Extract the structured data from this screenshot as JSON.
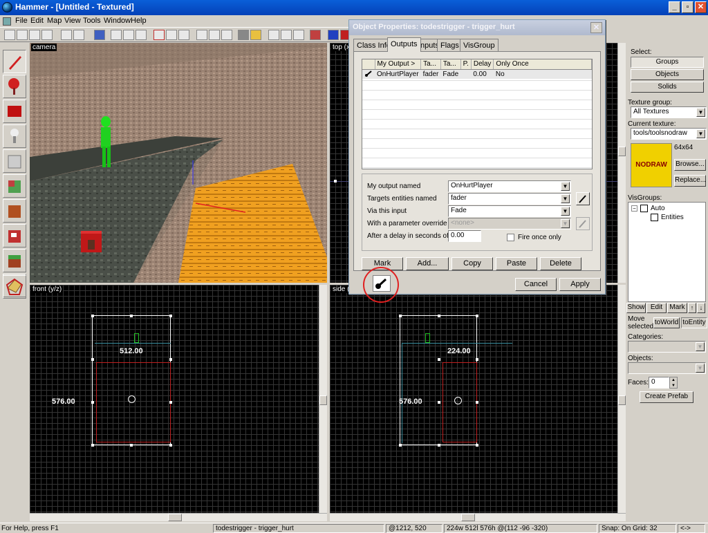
{
  "app": {
    "title": "Hammer - [Untitled - Textured]"
  },
  "menu": [
    "File",
    "Edit",
    "Map",
    "View",
    "Tools",
    "Window",
    "Help"
  ],
  "viewports": {
    "camera": "camera",
    "top": "top (x/",
    "front": "front (y/z)",
    "side": "side (x/"
  },
  "front_dims": {
    "width": "512.00",
    "height": "576.00"
  },
  "side_dims": {
    "width": "224.00",
    "height": "576.00"
  },
  "dialog": {
    "title": "Object Properties: todestrigger - trigger_hurt",
    "tabs": [
      "Class Info",
      "Outputs",
      "Inputs",
      "Flags",
      "VisGroup"
    ],
    "columns": [
      "My Output >",
      "Ta...",
      "Ta...",
      "P.",
      "Delay",
      "Only Once"
    ],
    "row": {
      "output": "OnHurtPlayer",
      "target": "fader",
      "input": "Fade",
      "delay": "0.00",
      "once": "No"
    },
    "labels": {
      "my_output": "My output named",
      "targets": "Targets entities named",
      "via_input": "Via this input",
      "param": "With a parameter override of",
      "delay": "After a delay in seconds of",
      "fire_once": "Fire once only"
    },
    "values": {
      "my_output": "OnHurtPlayer",
      "targets": "fader",
      "via_input": "Fade",
      "param": "<none>",
      "delay": "0.00"
    },
    "buttons": [
      "Mark",
      "Add...",
      "Copy",
      "Paste",
      "Delete"
    ],
    "cancel": "Cancel",
    "apply": "Apply"
  },
  "right": {
    "select_label": "Select:",
    "groups": "Groups",
    "objects": "Objects",
    "solids": "Solids",
    "texture_group_label": "Texture group:",
    "texture_group": "All Textures",
    "current_texture_label": "Current texture:",
    "current_texture": "tools/toolsnodraw",
    "texture_preview": "NODRAW",
    "texture_size": "64x64",
    "browse": "Browse...",
    "replace": "Replace...",
    "visgroups_label": "VisGroups:",
    "vis_auto": "Auto",
    "vis_entities": "Entities",
    "show": "Show",
    "edit": "Edit",
    "mark": "Mark",
    "move_selected": "Move selected:",
    "to_world": "toWorld",
    "to_entity": "toEntity",
    "categories_label": "Categories:",
    "objects_label": "Objects:",
    "faces_label": "Faces:",
    "faces_value": "0",
    "create_prefab": "Create Prefab"
  },
  "status": {
    "help": "For Help, press F1",
    "selection": "todestrigger - trigger_hurt",
    "cursor": "@1212, 520",
    "size": "224w 512l 576h @(112 -96 -320)",
    "snap": "Snap: On Grid: 32",
    "arrows": "<->"
  },
  "colors": {
    "titlebar": "#0a5fd8",
    "accent_red": "#e02020",
    "nodraw_yellow": "#f0d000"
  }
}
